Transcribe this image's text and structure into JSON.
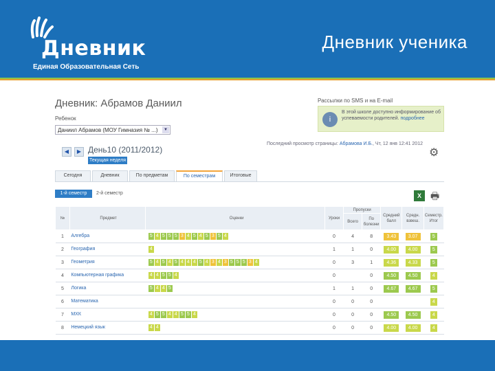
{
  "slide": {
    "title": "Дневник ученика",
    "logo_word": "Дневник",
    "logo_sub": "Единая Образовательная Сеть"
  },
  "page": {
    "heading": "Дневник: Абрамов Даниил",
    "pupil_label": "Ребенок",
    "pupil_select_value": "Даниил Абрамов (МОУ Гимназия № ...)",
    "period_title": "День10 (2011/2012)",
    "current_week_label": "Текущая неделя",
    "sms_link": "Рассылки по SMS и на E-mail",
    "info_text": "В этой школе доступно информирование об успеваемости родителей",
    "info_link": "подробнее",
    "last_view_prefix": "Последний просмотр страницы:",
    "last_view_who": "Абрамова И.Б.",
    "last_view_when": "Чт, 12 янв 12:41 2012"
  },
  "tabs": [
    {
      "label": "Сегодня",
      "w": 52
    },
    {
      "label": "Дневник",
      "w": 52
    },
    {
      "label": "По предметам",
      "w": 66
    },
    {
      "label": "По семестрам",
      "w": 68
    },
    {
      "label": "Итоговые",
      "w": 48
    }
  ],
  "active_tab": 3,
  "subbuttons": {
    "first": "1-й семестр",
    "second": "2-й семестр"
  },
  "table": {
    "headers": {
      "num": "№",
      "subject": "Предмет",
      "marks": "Оценки",
      "lessons": "Пропуски",
      "total": "Всего",
      "good_reason": "По болезни",
      "other": "Уроки",
      "avg": "Средний балл",
      "weighted": "Средн. взвеш.",
      "final": "Семестр. Итог"
    },
    "rows": [
      {
        "num": "1",
        "subject": "Алгебра",
        "marks": [
          "5",
          "4",
          "5",
          "5",
          "5",
          "3",
          "4",
          "5",
          "4",
          "5",
          "3",
          "5",
          "4"
        ],
        "p1": "0",
        "p2": "4",
        "p3": "8",
        "avg": "3.43",
        "weighted": "3.07",
        "final": "5"
      },
      {
        "num": "2",
        "subject": "География",
        "marks": [
          "4"
        ],
        "p1": "1",
        "p2": "1",
        "p3": "0",
        "avg": "4.00",
        "weighted": "4.00",
        "final": "5"
      },
      {
        "num": "3",
        "subject": "Геометрия",
        "marks": [
          "5",
          "4",
          "5",
          "4",
          "5",
          "4",
          "4",
          "4",
          "5",
          "4",
          "3",
          "4",
          "3",
          "5",
          "5",
          "5",
          "3",
          "4"
        ],
        "p1": "0",
        "p2": "3",
        "p3": "1",
        "avg": "4.36",
        "weighted": "4.33",
        "final": "5"
      },
      {
        "num": "4",
        "subject": "Компьютерная графика",
        "marks": [
          "4",
          "4",
          "5",
          "5",
          "4"
        ],
        "p1": "0",
        "p2": "",
        "p3": "0",
        "avg": "4.50",
        "weighted": "4.50",
        "final": "4"
      },
      {
        "num": "5",
        "subject": "Логика",
        "marks": [
          "5",
          "4",
          "4",
          "5"
        ],
        "p1": "1",
        "p2": "1",
        "p3": "0",
        "avg": "4.67",
        "weighted": "4.67",
        "final": "5"
      },
      {
        "num": "6",
        "subject": "Математика",
        "marks": [],
        "p1": "0",
        "p2": "0",
        "p3": "0",
        "avg": "",
        "weighted": "",
        "final": "4"
      },
      {
        "num": "7",
        "subject": "МХК",
        "marks": [
          "4",
          "5",
          "5",
          "4",
          "4",
          "5",
          "5",
          "4"
        ],
        "p1": "0",
        "p2": "0",
        "p3": "0",
        "avg": "4.50",
        "weighted": "4.50",
        "final": "4"
      },
      {
        "num": "8",
        "subject": "Немецкий язык",
        "marks": [
          "4",
          "4"
        ],
        "p1": "0",
        "p2": "0",
        "p3": "0",
        "avg": "4.00",
        "weighted": "4.00",
        "final": "4"
      }
    ]
  },
  "colors": {
    "brand_blue": "#1a6fb7",
    "accent_green": "#8ec34a",
    "accent_orange": "#e8a030"
  }
}
